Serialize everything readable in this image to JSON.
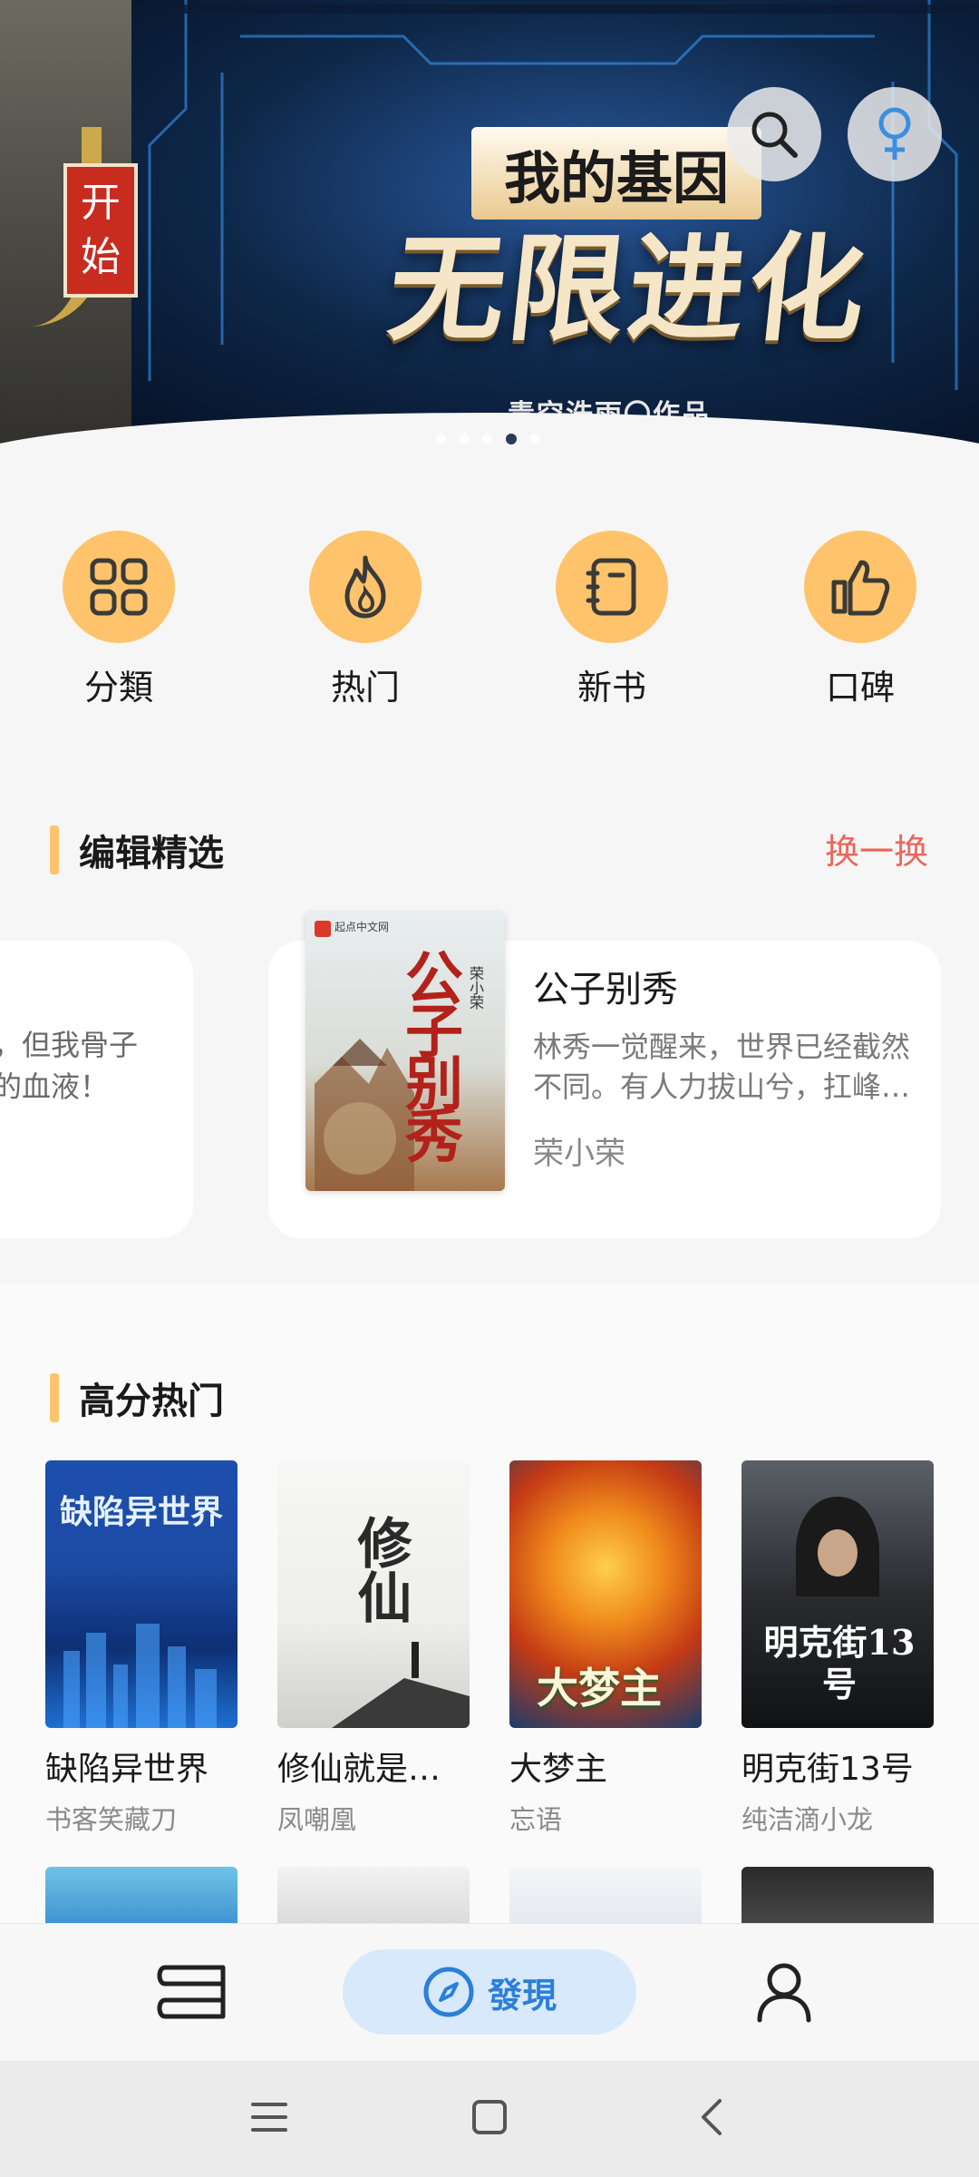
{
  "banner": {
    "left_seal": "开始",
    "title_small": "我的基因",
    "title_big": "无限进化",
    "author": "青空洗雨〇作品",
    "dots_count": 5,
    "active_dot": 3,
    "search_icon": "search-icon",
    "gender_icon": "female-icon"
  },
  "quick_nav": [
    {
      "label": "分類",
      "icon": "grid-icon"
    },
    {
      "label": "热门",
      "icon": "flame-icon"
    },
    {
      "label": "新书",
      "icon": "notebook-icon"
    },
    {
      "label": "口碑",
      "icon": "thumbs-up-icon"
    }
  ],
  "editor_picks": {
    "title": "编辑精选",
    "refresh": "换一换",
    "prev_card_text": [
      "神，但我骨子",
      "愉的血液！"
    ],
    "current": {
      "name": "公子别秀",
      "description": "林秀一觉醒来，世界已经截然不同。有人力拔山兮，扛峰…",
      "author": "荣小荣",
      "cover_title": "公子别秀",
      "cover_author": "荣小荣"
    }
  },
  "hot": {
    "title": "高分热门",
    "books": [
      {
        "title": "缺陷异世界",
        "author": "书客笑藏刀",
        "cover_text": "缺陷异世界"
      },
      {
        "title": "修仙就是…",
        "author": "凤嘲凰",
        "cover_text": "修仙"
      },
      {
        "title": "大梦主",
        "author": "忘语",
        "cover_text": "大梦主"
      },
      {
        "title": "明克街13号",
        "author": "纯洁滴小龙",
        "cover_text": "明克街13号"
      }
    ]
  },
  "bottom_nav": {
    "shelf_icon": "bookshelf-icon",
    "discover_label": "發現",
    "discover_icon": "compass-icon",
    "me_icon": "user-icon"
  },
  "colors": {
    "accent_orange": "#ffc46b",
    "refresh_red": "#e9675a",
    "discover_blue": "#2c7fd8"
  }
}
